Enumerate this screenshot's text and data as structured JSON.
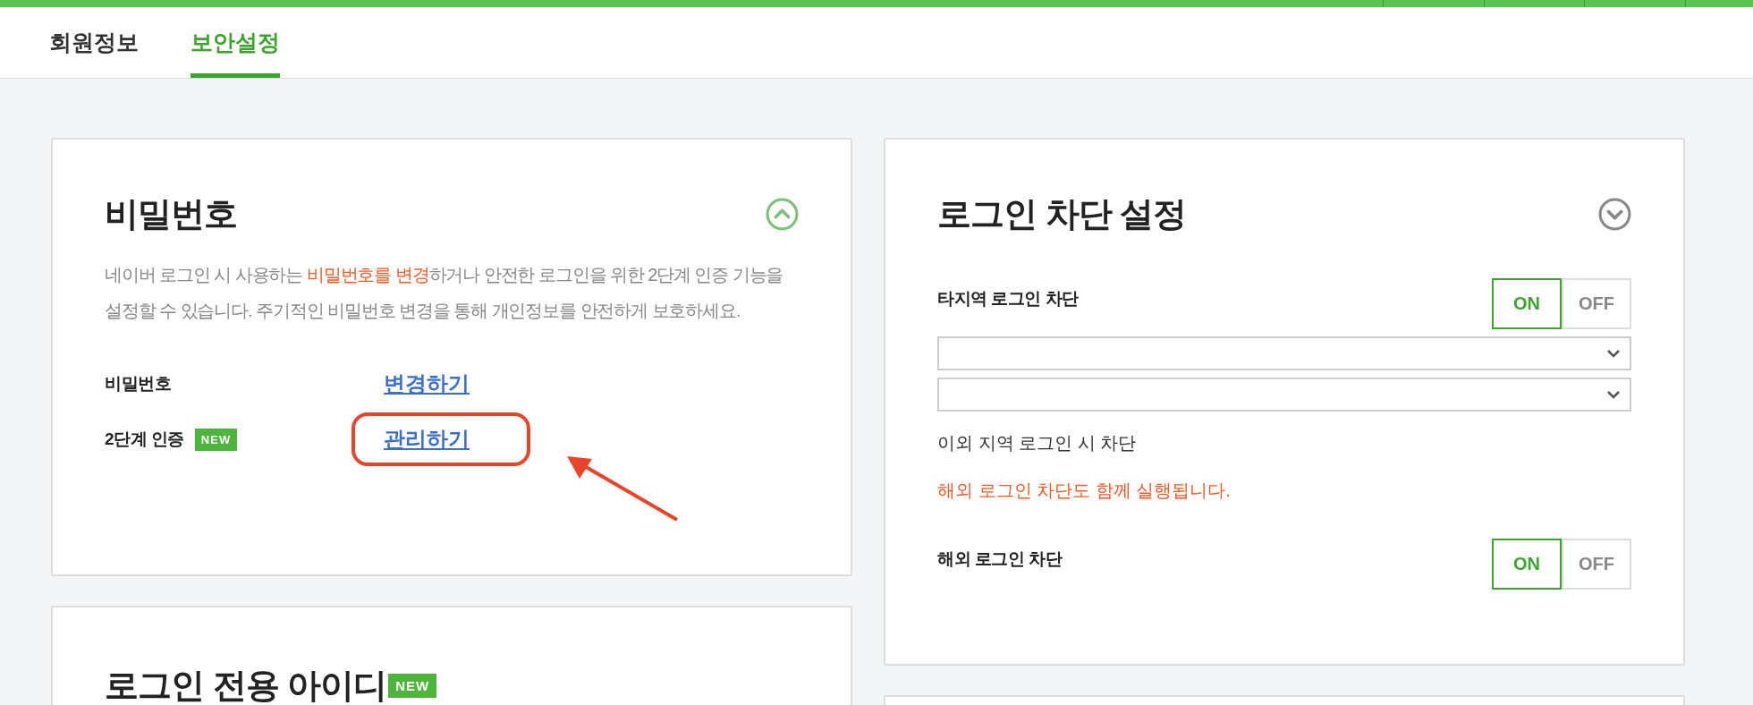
{
  "tabs": [
    {
      "label": "회원정보",
      "selected": false
    },
    {
      "label": "보안설정",
      "selected": true
    }
  ],
  "password_card": {
    "title": "비밀번호",
    "expanded": true,
    "description": "네이버 로그인 시 사용하는 **비밀번호를 변경**하거나 안전한 로그인을 위한 2단계 인증 기능을 설정할 수 있습니다. 주기적인 비밀번호 변경을 통해 개인정보를 안전하게 보호하세요.",
    "rows": [
      {
        "label": "비밀번호",
        "link": "변경하기",
        "annotated": false
      },
      {
        "label": "2단계 인증",
        "badge": "NEW",
        "link": "관리하기",
        "annotated": true
      }
    ]
  },
  "login_block_card": {
    "title": "로그인 차단 설정",
    "expanded": false,
    "regional": {
      "label": "타지역 로그인 차단",
      "toggle": [
        {
          "label": "ON",
          "selected": true
        },
        {
          "label": "OFF",
          "selected": false
        }
      ]
    },
    "dropdowns": [
      {
        "expanded": false
      },
      {
        "expanded": false
      }
    ],
    "note": "이외 지역 로그인 시 차단",
    "warning": "해외 로그인 차단도 함께 실행됩니다.",
    "overseas": {
      "label": "해외 로그인 차단",
      "toggle": [
        {
          "label": "ON",
          "selected": true
        },
        {
          "label": "OFF",
          "selected": false
        }
      ]
    }
  },
  "login_id_card": {
    "title": "로그인 전용 아이디",
    "badge": "NEW"
  }
}
